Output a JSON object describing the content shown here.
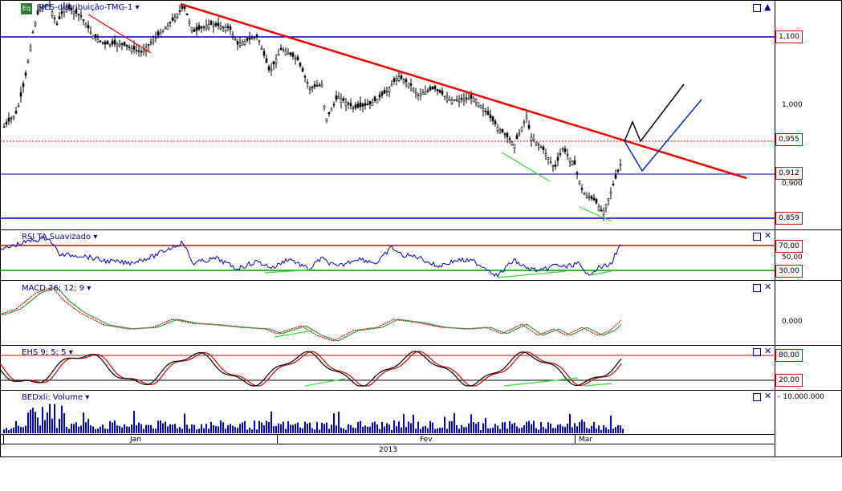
{
  "chart_data": [
    {
      "type": "candlestick",
      "title": "SIES-distribuição-TMG-1",
      "price_levels": [
        1.1,
        0.955,
        0.912,
        0.859
      ],
      "y_ticks": [
        "1,000",
        "0,900"
      ],
      "level_labels": [
        "1,100",
        "0,955",
        "0,912",
        "0,859"
      ],
      "annotations": [
        "descending resistance trendline",
        "projected bounce paths"
      ]
    },
    {
      "type": "line",
      "title": "RSI TA Suavizado",
      "levels": [
        70,
        30
      ],
      "level_labels": [
        "70,00",
        "30,00"
      ],
      "y_ticks": [
        "50,00"
      ]
    },
    {
      "type": "line",
      "title": "MACD 26; 12; 9",
      "y_ticks": [
        "0,000"
      ]
    },
    {
      "type": "line",
      "title": "EHS 9; 5; 5",
      "levels": [
        80,
        20
      ],
      "level_labels": [
        "80,00",
        "20,00"
      ]
    },
    {
      "type": "bar",
      "title": "BEDxli: Volume",
      "y_ticks": [
        "10.000.000"
      ]
    }
  ],
  "x_axis": {
    "months": [
      "Jan",
      "Fev",
      "Mar"
    ],
    "year": "2013"
  },
  "ui": {
    "eq_label": "Eq"
  }
}
